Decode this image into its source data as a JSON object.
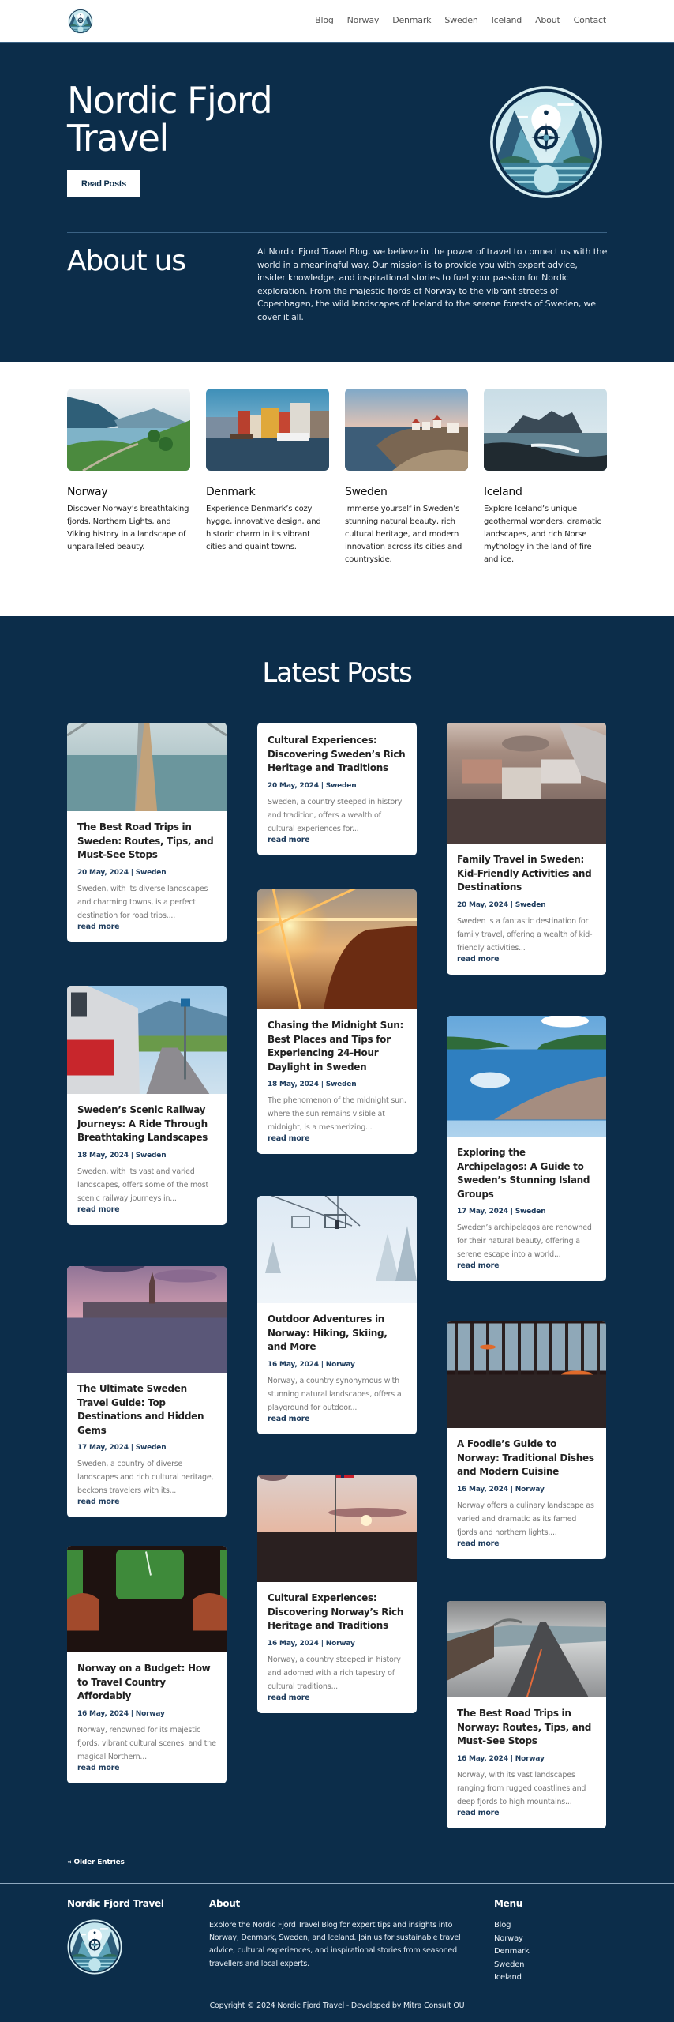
{
  "header": {
    "logo_alt": "Nordic Fjord Travel logo",
    "nav": [
      "Blog",
      "Norway",
      "Denmark",
      "Sweden",
      "Iceland",
      "About",
      "Contact"
    ]
  },
  "hero": {
    "title": "Nordic Fjord Travel",
    "button_label": "Read Posts"
  },
  "about": {
    "title": "About us",
    "text": "At Nordic Fjord Travel Blog, we believe in the power of travel to connect us with the world in a meaningful way. Our mission is to provide you with expert advice, insider knowledge, and inspirational stories to fuel your passion for Nordic exploration. From the majestic fjords of Norway to the vibrant streets of Copenhagen, the wild landscapes of Iceland to the serene forests of Sweden, we cover it all."
  },
  "countries": [
    {
      "name": "Norway",
      "text": "Discover Norway’s breathtaking fjords, Northern Lights, and Viking history in a landscape of unparalleled beauty.",
      "image": "fjord-valley"
    },
    {
      "name": "Denmark",
      "text": "Experience Denmark’s cozy hygge, innovative design, and historic charm in its vibrant cities and quaint towns.",
      "image": "nyhavn-harbor"
    },
    {
      "name": "Sweden",
      "text": "Immerse yourself in Sweden’s stunning natural beauty, rich cultural heritage, and modern innovation across its cities and countryside.",
      "image": "coastal-village"
    },
    {
      "name": "Iceland",
      "text": "Explore Iceland’s unique geothermal wonders, dramatic landscapes, and rich Norse mythology in the land of fire and ice.",
      "image": "black-sand-coast"
    }
  ],
  "latest": {
    "title": "Latest Posts",
    "read_more": "read more",
    "posts": [
      {
        "title": "The Best Road Trips in Sweden: Routes, Tips, and Must-See Stops",
        "date": "20 May, 2024",
        "category": "Sweden",
        "excerpt": "Sweden, with its diverse landscapes and charming towns, is a perfect destination for road trips....",
        "image": "bridge"
      },
      {
        "title": "Cultural Experiences: Discovering Sweden’s Rich Heritage and Traditions",
        "date": "20 May, 2024",
        "category": "Sweden",
        "excerpt": "Sweden, a country steeped in history and tradition, offers a wealth of cultural experiences for...",
        "image": null
      },
      {
        "title": "Family Travel in Sweden: Kid-Friendly Activities and Destinations",
        "date": "20 May, 2024",
        "category": "Sweden",
        "excerpt": "Sweden is a fantastic destination for family travel, offering a wealth of kid-friendly activities...",
        "image": "aerial-city"
      },
      {
        "title": "Sweden’s Scenic Railway Journeys: A Ride Through Breathtaking Landscapes",
        "date": "18 May, 2024",
        "category": "Sweden",
        "excerpt": "Sweden, with its vast and varied landscapes, offers some of the most scenic railway journeys in...",
        "image": "train-platform"
      },
      {
        "title": "Chasing the Midnight Sun: Best Places and Tips for Experiencing 24-Hour Daylight in Sweden",
        "date": "18 May, 2024",
        "category": "Sweden",
        "excerpt": "The phenomenon of the midnight sun, where the sun remains visible at midnight, is a mesmerizing...",
        "image": "midnight-sun"
      },
      {
        "title": "Exploring the Archipelagos: A Guide to Sweden’s Stunning Island Groups",
        "date": "17 May, 2024",
        "category": "Sweden",
        "excerpt": "Sweden’s archipelagos are renowned for their natural beauty, offering a serene escape into a world...",
        "image": "lake"
      },
      {
        "title": "The Ultimate Sweden Travel Guide: Top Destinations and Hidden Gems",
        "date": "17 May, 2024",
        "category": "Sweden",
        "excerpt": "Sweden, a country of diverse landscapes and rich cultural heritage, beckons travelers with its...",
        "image": "stockholm-dusk"
      },
      {
        "title": "Outdoor Adventures in Norway: Hiking, Skiing, and More",
        "date": "16 May, 2024",
        "category": "Norway",
        "excerpt": "Norway, a country synonymous with stunning natural landscapes, offers a playground for outdoor...",
        "image": "ski-lift"
      },
      {
        "title": "A Foodie’s Guide to Norway: Traditional Dishes and Modern Cuisine",
        "date": "16 May, 2024",
        "category": "Norway",
        "excerpt": "Norway offers a culinary landscape as varied and dramatic as its famed fjords and northern lights....",
        "image": "restaurant"
      },
      {
        "title": "Norway on a Budget: How to Travel Country Affordably",
        "date": "16 May, 2024",
        "category": "Norway",
        "excerpt": "Norway, renowned for its majestic fjords, vibrant cultural scenes, and the magical Northern...",
        "image": "train-window"
      },
      {
        "title": "Cultural Experiences: Discovering Norway’s Rich Heritage and Traditions",
        "date": "16 May, 2024",
        "category": "Norway",
        "excerpt": "Norway, a country steeped in history and adorned with a rich tapestry of cultural traditions,...",
        "image": "norway-flag"
      },
      {
        "title": "The Best Road Trips in Norway: Routes, Tips, and Must-See Stops",
        "date": "16 May, 2024",
        "category": "Norway",
        "excerpt": "Norway, with its vast landscapes ranging from rugged coastlines and deep fjords to high mountains...",
        "image": "coastal-road"
      }
    ]
  },
  "pagination": {
    "older_label": "« Older Entries"
  },
  "footer": {
    "brand_title": "Nordic Fjord Travel",
    "about_title": "About",
    "about_text": "Explore the Nordic Fjord Travel Blog for expert tips and insights into Norway, Denmark, Sweden, and Iceland. Join us for sustainable travel advice, cultural experiences, and inspirational stories from seasoned travellers and local experts.",
    "menu_title": "Menu",
    "menu": [
      "Blog",
      "Norway",
      "Denmark",
      "Sweden",
      "Iceland"
    ],
    "copyright": "Copyright © 2024 Nordic Fjord Travel - Developed by ",
    "developer": "Mitra Consult OÜ"
  },
  "colors": {
    "brand_dark": "#0c2d4a",
    "meta_text": "#1f3d5e",
    "excerpt_text": "#777777"
  }
}
